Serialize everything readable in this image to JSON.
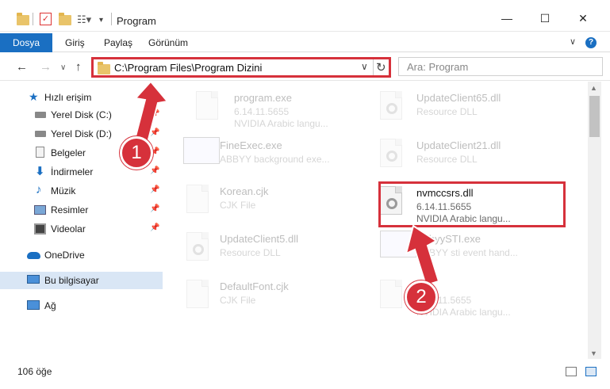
{
  "window": {
    "title": "Program",
    "minimize": "—",
    "maximize": "☐",
    "close": "✕"
  },
  "ribbon": {
    "file_tab": "Dosya",
    "tabs": [
      "Giriş",
      "Paylaş",
      "Görünüm"
    ],
    "help": "?",
    "collapse": "∨"
  },
  "address": {
    "path": "C:\\Program Files\\Program Dizini",
    "search_placeholder": "Ara: Program"
  },
  "sidebar": {
    "quick_access": "Hızlı erişim",
    "items": [
      {
        "label": "Yerel Disk (C:)",
        "icon": "drive-icon",
        "pinned": true
      },
      {
        "label": "Yerel Disk (D:)",
        "icon": "drive-icon",
        "pinned": true
      },
      {
        "label": "Belgeler",
        "icon": "documents-icon",
        "pinned": true
      },
      {
        "label": "İndirmeler",
        "icon": "downloads-icon",
        "pinned": true
      },
      {
        "label": "Müzik",
        "icon": "music-icon",
        "pinned": true
      },
      {
        "label": "Resimler",
        "icon": "pictures-icon",
        "pinned": true
      },
      {
        "label": "Videolar",
        "icon": "videos-icon",
        "pinned": true
      }
    ],
    "onedrive": "OneDrive",
    "this_pc": "Bu bilgisayar",
    "network": "Ağ"
  },
  "files": [
    {
      "name": "program.exe",
      "line1": "6.14.11.5655",
      "line2": "NVIDIA Arabic langu..."
    },
    {
      "name": "UpdateClient65.dll",
      "line1": "Resource DLL",
      "line2": ""
    },
    {
      "name": "FineExec.exe",
      "line1": "ABBYY background exe...",
      "line2": ""
    },
    {
      "name": "UpdateClient21.dll",
      "line1": "Resource DLL",
      "line2": ""
    },
    {
      "name": "Korean.cjk",
      "line1": "CJK File",
      "line2": ""
    },
    {
      "name": "nvmccsrs.dll",
      "line1": "6.14.11.5655",
      "line2": "NVIDIA Arabic langu..."
    },
    {
      "name": "UpdateClient5.dll",
      "line1": "Resource DLL",
      "line2": ""
    },
    {
      "name": "AbbyySTI.exe",
      "line1": "ABBYY sti event hand...",
      "line2": ""
    },
    {
      "name": "DefaultFont.cjk",
      "line1": "CJK File",
      "line2": ""
    },
    {
      "name": "",
      "line1": "6.14.11.5655",
      "line2": "NVIDIA Arabic langu..."
    }
  ],
  "status": {
    "count": "106 öğe"
  },
  "callouts": [
    "1",
    "2"
  ],
  "colors": {
    "accent": "#1a6fc2",
    "highlight": "#d6313b",
    "selected_nav": "#d9e6f5"
  }
}
